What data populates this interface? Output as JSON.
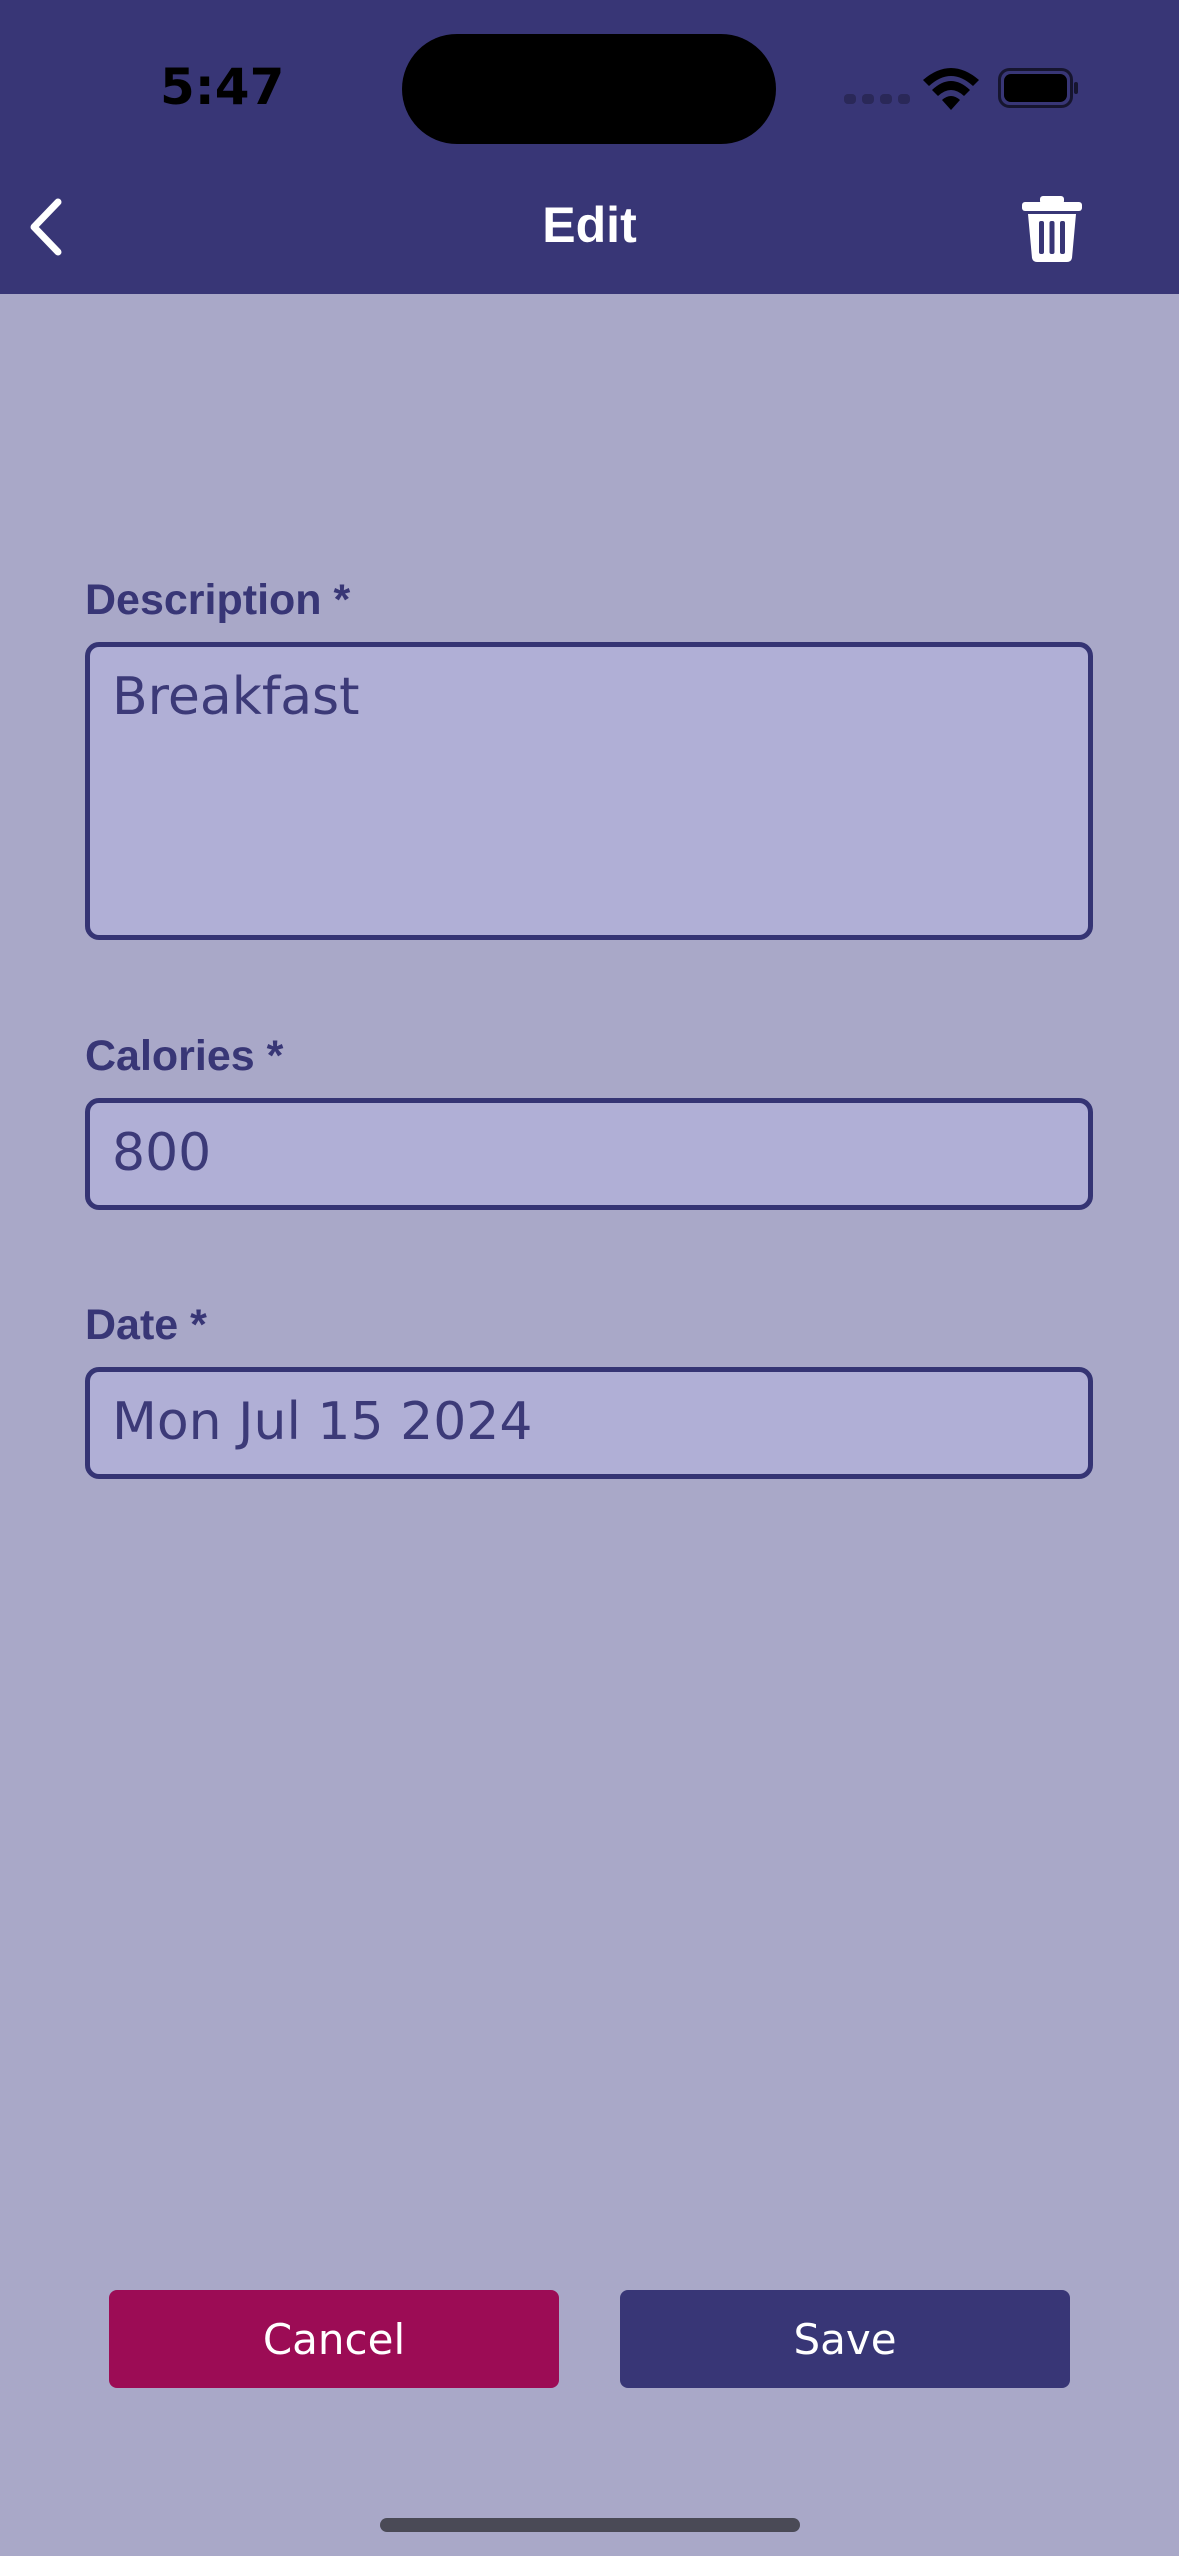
{
  "status_bar": {
    "time": "5:47"
  },
  "header": {
    "title": "Edit",
    "back_icon": "chevron-left-icon",
    "delete_icon": "trash-icon"
  },
  "form": {
    "description": {
      "label": "Description *",
      "value": "Breakfast"
    },
    "calories": {
      "label": "Calories *",
      "value": "800"
    },
    "date": {
      "label": "Date *",
      "value": "Mon Jul 15 2024"
    }
  },
  "actions": {
    "cancel_label": "Cancel",
    "save_label": "Save"
  },
  "colors": {
    "header_bg": "#383676",
    "page_bg": "#a9a8c8",
    "field_bg": "#b0afd6",
    "cancel_bg": "#9c0c55",
    "save_bg": "#383676"
  }
}
